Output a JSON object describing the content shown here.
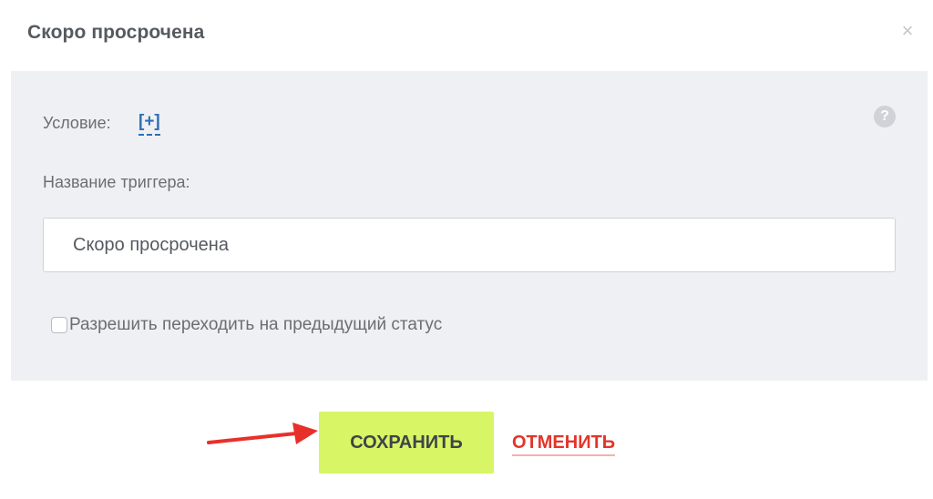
{
  "dialog": {
    "title": "Скоро просрочена",
    "close_icon": "close-icon",
    "close_glyph": "×"
  },
  "form": {
    "condition_label": "Условие:",
    "condition_add": "[+]",
    "help_icon": "help-icon",
    "help_glyph": "?",
    "name_label": "Название триггера:",
    "name_value": "Скоро просрочена",
    "checkbox_label": "Разрешить переходить на предыдущий статус",
    "checkbox_checked": false
  },
  "actions": {
    "save_label": "СОХРАНИТЬ",
    "cancel_label": "ОТМЕНИТЬ"
  },
  "annotation": {
    "arrow_icon": "red-arrow-icon"
  },
  "colors": {
    "panel_bg": "#eef0f3",
    "save_bg": "#d7f565",
    "cancel_text": "#e3352a",
    "link_blue": "#2f6fb6",
    "arrow_red": "#e8302a"
  }
}
